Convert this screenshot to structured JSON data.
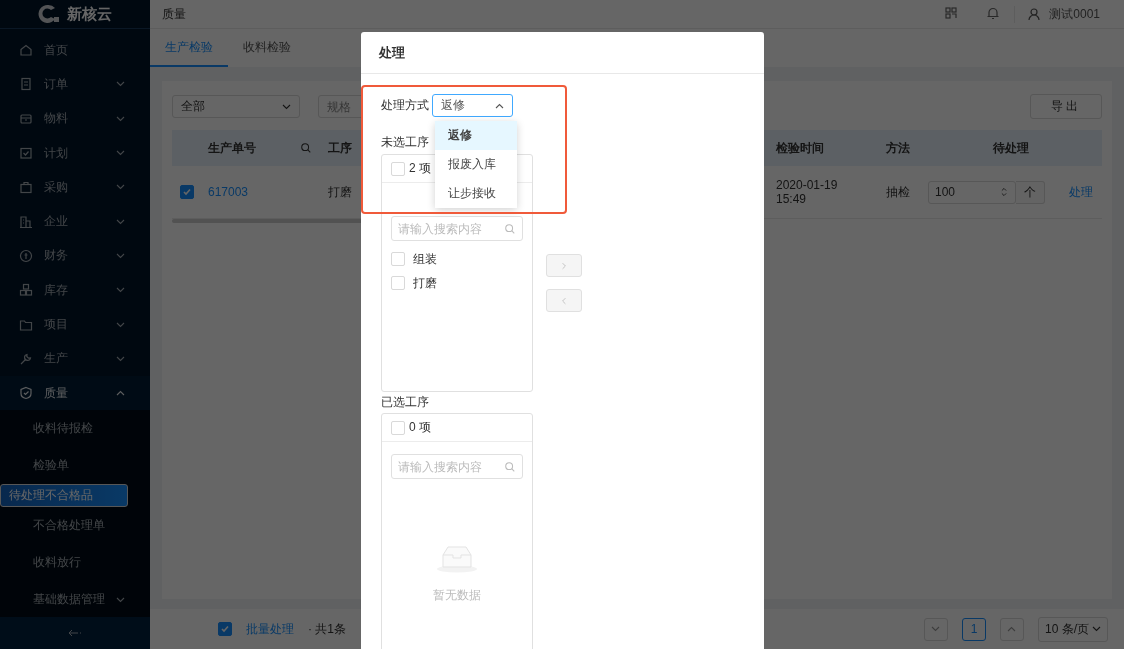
{
  "app": {
    "logo": "新核云"
  },
  "sidebar": {
    "items": [
      {
        "label": "首页",
        "kind": "link"
      },
      {
        "label": "订单",
        "kind": "group",
        "expanded": false
      },
      {
        "label": "物料",
        "kind": "group",
        "expanded": false
      },
      {
        "label": "计划",
        "kind": "group",
        "expanded": false
      },
      {
        "label": "采购",
        "kind": "group",
        "expanded": false
      },
      {
        "label": "企业",
        "kind": "group",
        "expanded": false
      },
      {
        "label": "财务",
        "kind": "group",
        "expanded": false
      },
      {
        "label": "库存",
        "kind": "group",
        "expanded": false
      },
      {
        "label": "项目",
        "kind": "group",
        "expanded": false
      },
      {
        "label": "生产",
        "kind": "group",
        "expanded": false
      },
      {
        "label": "质量",
        "kind": "group",
        "expanded": true,
        "children": [
          {
            "label": "收料待报检",
            "selected": false,
            "kind": "link"
          },
          {
            "label": "检验单",
            "selected": false,
            "kind": "link"
          },
          {
            "label": "待处理不合格品",
            "selected": true,
            "kind": "link"
          },
          {
            "label": "不合格处理单",
            "selected": false,
            "kind": "link"
          },
          {
            "label": "收料放行",
            "selected": false,
            "kind": "link"
          },
          {
            "label": "基础数据管理",
            "selected": false,
            "kind": "group",
            "expanded": false
          }
        ]
      }
    ]
  },
  "header": {
    "breadcrumb": "质量",
    "user": "测试0001"
  },
  "tabs": [
    {
      "label": "生产检验",
      "selected": true
    },
    {
      "label": "收料检验",
      "selected": false
    }
  ],
  "filters": {
    "status": "全部",
    "spec_placeholder": "规格"
  },
  "export_button": "导出",
  "table": {
    "columns": [
      {
        "label": "生产单号",
        "searchable": true
      },
      {
        "label": "工序",
        "searchable": false
      },
      {
        "label": "检验时间",
        "searchable": false
      },
      {
        "label": "方法",
        "searchable": false
      },
      {
        "label": "待处理",
        "searchable": false
      }
    ],
    "rows": [
      {
        "selected": true,
        "order_no": "617003",
        "process": "打磨",
        "time": "2020-01-19 15:49",
        "method": "抽检",
        "quantity": "100",
        "unit": "个",
        "action": "处理"
      }
    ]
  },
  "footer": {
    "select_all": true,
    "batch_link": "批量处理",
    "total": "· 共1条",
    "pages": [
      {
        "label": "1",
        "selected": true
      }
    ],
    "page_size": "10 条/页"
  },
  "modal": {
    "title": "处理",
    "method_label": "处理方式",
    "method_value": "返修",
    "dropdown_open": true,
    "options": [
      {
        "label": "返修",
        "selected": true
      },
      {
        "label": "报废入库",
        "selected": false
      },
      {
        "label": "让步接收",
        "selected": false
      }
    ],
    "source": {
      "title": "未选工序",
      "count": "2 项",
      "checked": false,
      "search_placeholder": "请输入搜索内容",
      "items": [
        {
          "label": "组装",
          "checked": false
        },
        {
          "label": "打磨",
          "checked": false
        }
      ]
    },
    "target": {
      "title": "已选工序",
      "count": "0 项",
      "checked": false,
      "search_placeholder": "请输入搜索内容",
      "empty_text": "暂无数据"
    }
  }
}
